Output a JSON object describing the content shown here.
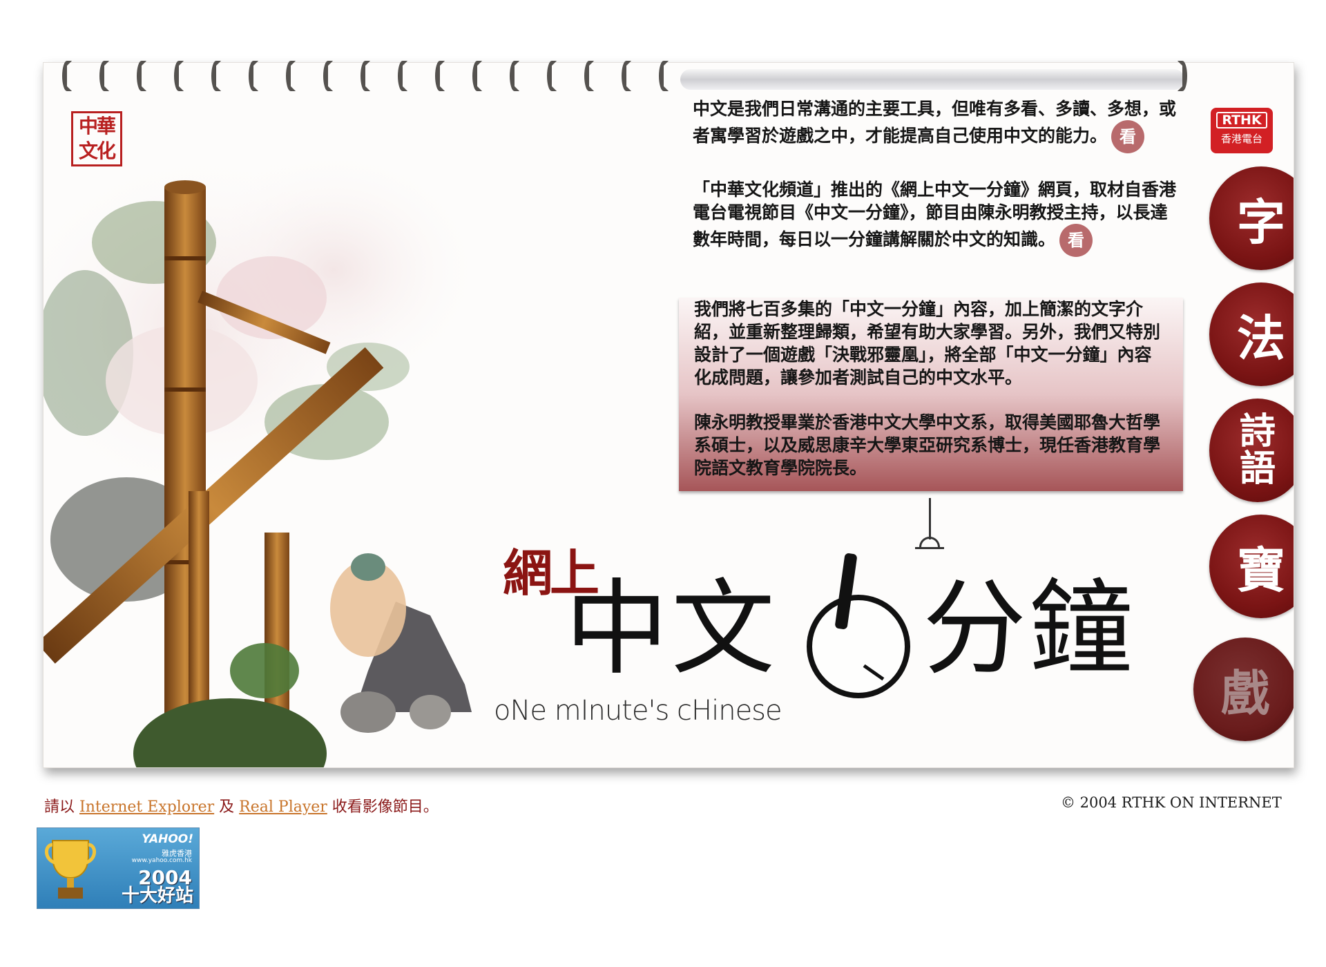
{
  "seal": {
    "text": "中華文化"
  },
  "rthk_logo": {
    "top": "RTHK",
    "bottom": "香港電台"
  },
  "intro": {
    "p1": "中文是我們日常溝通的主要工具，但唯有多看、多讀、多想，或者寓學習於遊戲之中，才能提高自己使用中文的能力。",
    "p2": "「中華文化頻道」推出的《網上中文一分鐘》網頁，取材自香港電台電視節目《中文一分鐘》，節目由陳永明教授主持，以長達數年時間，每日以一分鐘講解關於中文的知識。",
    "p3": "我們將七百多集的「中文一分鐘」內容，加上簡潔的文字介紹，並重新整理歸類，希望有助大家學習。另外，我們又特別設計了一個遊戲「決戰邪靈凰」，將全部「中文一分鐘」內容化成問題，讓參加者測試自己的中文水平。",
    "p4": "陳永明教授畢業於香港中文大學中文系，取得美國耶魯大哲學系碩士，以及威思康辛大學東亞研究系博士，現任香港教育學院語文教育學院院長。",
    "look_label": "看"
  },
  "logo": {
    "sub": "網上",
    "main_left": "中文",
    "main_right": "分鐘",
    "english": "oNe mInute's cHinese"
  },
  "side_menu": [
    {
      "label": "字"
    },
    {
      "label": "法"
    },
    {
      "label": "詩語"
    },
    {
      "label": "寶"
    },
    {
      "label": "戲"
    }
  ],
  "footer": {
    "prefix": "請以 ",
    "ie_link": "Internet Explorer",
    "and": " 及 ",
    "rp_link": "Real Player",
    "suffix": " 收看影像節目。",
    "copyright": "© 2004 RTHK ON INTERNET"
  },
  "badge": {
    "logo": "YAHOO!",
    "sub": "雅虎香港",
    "url": "www.yahoo.com.hk",
    "year": "2004",
    "rank": "十大好站"
  },
  "colors": {
    "accent": "#8b1412",
    "menu_red": "#7a1414",
    "link": "#c8742a"
  }
}
